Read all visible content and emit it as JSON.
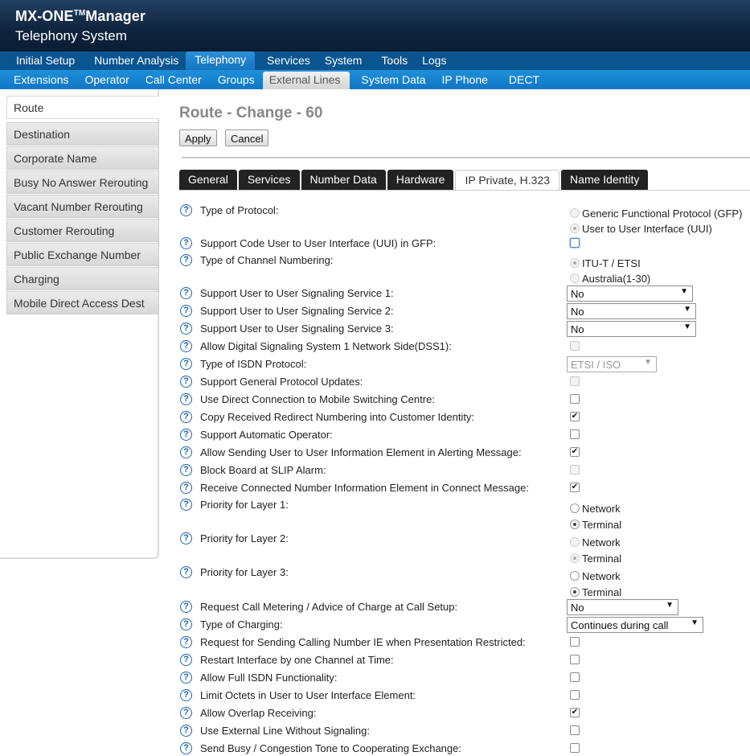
{
  "app": {
    "title": "MX-ONE",
    "title_tm": "TM",
    "title_suffix": "Manager",
    "subtitle": "Telephony System"
  },
  "nav_main": [
    "Initial Setup",
    "Number Analysis",
    "Telephony",
    "Services",
    "System",
    "Tools",
    "Logs"
  ],
  "nav_main_active": "Telephony",
  "nav_sub": [
    "Extensions",
    "Operator",
    "Call Center",
    "Groups",
    "External Lines",
    "System Data",
    "IP Phone",
    "DECT"
  ],
  "nav_sub_active": "External Lines",
  "sidebar": [
    "Route",
    "Destination",
    "Corporate Name",
    "Busy No Answer Rerouting",
    "Vacant Number Rerouting",
    "Customer Rerouting",
    "Public Exchange Number",
    "Charging",
    "Mobile Direct Access Dest"
  ],
  "page_title": "Route - Change - 60",
  "buttons": {
    "apply": "Apply",
    "cancel": "Cancel"
  },
  "tabs": [
    "General",
    "Services",
    "Number Data",
    "Hardware",
    "IP Private, H.323",
    "Name Identity"
  ],
  "tabs_active": "IP Private, H.323",
  "help_glyph": "?",
  "check_glyph": "✔",
  "dropdown_glyph": "▼",
  "form": {
    "type_of_protocol": {
      "label": "Type of Protocol:",
      "options": [
        "Generic Functional Protocol (GFP)",
        "User to User Interface (UUI)"
      ],
      "selected": 1
    },
    "support_uui_gfp": {
      "label": "Support Code User to User Interface (UUI) in GFP:",
      "checked": false
    },
    "channel_numbering": {
      "label": "Type of Channel Numbering:",
      "options": [
        "ITU-T / ETSI",
        "Australia(1-30)"
      ],
      "selected": 0
    },
    "uuss1": {
      "label": "Support User to User Signaling Service 1:",
      "value": "No"
    },
    "uuss2": {
      "label": "Support User to User Signaling Service 2:",
      "value": "No"
    },
    "uuss3": {
      "label": "Support User to User Signaling Service 3:",
      "value": "No"
    },
    "dss1": {
      "label": "Allow Digital Signaling System 1 Network Side(DSS1):",
      "checked": false
    },
    "isdn_protocol": {
      "label": "Type of ISDN Protocol:",
      "value": "ETSI / ISO"
    },
    "general_protocol_updates": {
      "label": "Support General Protocol Updates:",
      "checked": false
    },
    "direct_conn_msc": {
      "label": "Use Direct Connection to Mobile Switching Centre:",
      "checked": false
    },
    "copy_redirect": {
      "label": "Copy Received Redirect Numbering into Customer Identity:",
      "checked": true
    },
    "auto_operator": {
      "label": "Support Automatic Operator:",
      "checked": false
    },
    "uui_alerting": {
      "label": "Allow Sending User to User Information Element in Alerting Message:",
      "checked": true
    },
    "block_slip": {
      "label": "Block Board at SLIP Alarm:",
      "checked": false
    },
    "connected_number": {
      "label": "Receive Connected Number Information Element in Connect Message:",
      "checked": true
    },
    "priority_layer1": {
      "label": "Priority for Layer 1:",
      "options": [
        "Network",
        "Terminal"
      ],
      "selected": 1
    },
    "priority_layer2": {
      "label": "Priority for Layer 2:",
      "options": [
        "Network",
        "Terminal"
      ],
      "selected": 1
    },
    "priority_layer3": {
      "label": "Priority for Layer 3:",
      "options": [
        "Network",
        "Terminal"
      ],
      "selected": 1
    },
    "call_metering": {
      "label": "Request Call Metering / Advice of Charge at Call Setup:",
      "value": "No"
    },
    "type_of_charging": {
      "label": "Type of Charging:",
      "value": "Continues during call"
    },
    "calling_number_ie": {
      "label": "Request for Sending Calling Number IE when Presentation Restricted:",
      "checked": false
    },
    "restart_interface": {
      "label": "Restart Interface by one Channel at Time:",
      "checked": false
    },
    "full_isdn": {
      "label": "Allow Full ISDN Functionality:",
      "checked": false
    },
    "limit_octets": {
      "label": "Limit Octets in User to User Interface Element:",
      "checked": false
    },
    "overlap_receiving": {
      "label": "Allow Overlap Receiving:",
      "checked": true
    },
    "external_line_no_sig": {
      "label": "Use External Line Without Signaling:",
      "checked": false
    },
    "busy_congestion": {
      "label": "Send Busy / Congestion Tone to Cooperating Exchange:",
      "checked": false
    }
  }
}
